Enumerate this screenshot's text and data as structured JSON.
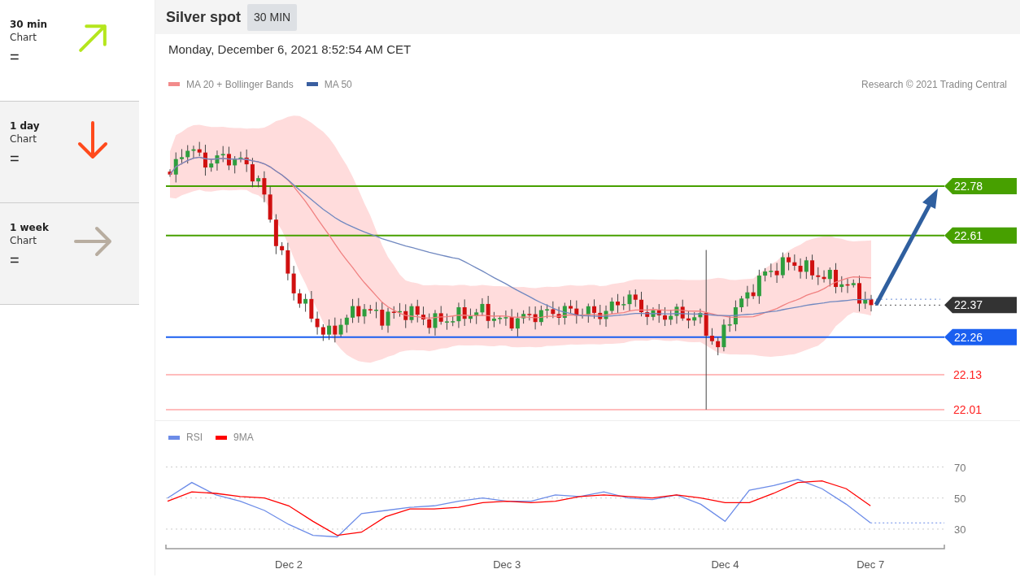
{
  "sidebar": {
    "items": [
      {
        "title": "30 min",
        "subtitle": "Chart",
        "sign": "=",
        "kind": "rising",
        "color": "#b5e61d",
        "selected": true
      },
      {
        "title": "1 day",
        "subtitle": "Chart",
        "sign": "=",
        "kind": "falling",
        "color": "#ff4a1c",
        "selected": false
      },
      {
        "title": "1 week",
        "subtitle": "Chart",
        "sign": "=",
        "kind": "flat",
        "color": "#b8ada0",
        "selected": false
      }
    ]
  },
  "header": {
    "title": "Silver spot",
    "badge": "30 MIN"
  },
  "timestamp": "Monday, December 6, 2021 8:52:54 AM CET",
  "price_chart": {
    "legend": [
      {
        "label": "MA 20 + Bollinger Bands",
        "color": "#f28b8b"
      },
      {
        "label": "MA 50",
        "color": "#3a5fa0"
      }
    ],
    "credit": "Research © 2021 Trading Central",
    "levels": [
      {
        "label": "22.78",
        "kind": "tag",
        "color": "#47a000"
      },
      {
        "label": "22.61",
        "kind": "tag",
        "color": "#47a000"
      },
      {
        "label": "22.37",
        "kind": "last",
        "color": "#333333"
      },
      {
        "label": "22.26",
        "kind": "tag",
        "color": "#1a5ff0"
      },
      {
        "label": "22.13",
        "kind": "text",
        "color": "#ff2020"
      },
      {
        "label": "22.01",
        "kind": "text",
        "color": "#ff2020"
      }
    ]
  },
  "rsi_chart": {
    "chart_data": {
      "type": "line",
      "grid": true,
      "ylim": [
        17.4,
        70
      ],
      "categories": [
        null,
        null,
        null,
        null,
        null,
        "Dec 2",
        null,
        null,
        null,
        null,
        null,
        null,
        null,
        null,
        "Dec 3",
        null,
        null,
        null,
        null,
        null,
        null,
        null,
        null,
        "Dec 4",
        null,
        null,
        null,
        null,
        null,
        "Dec 7"
      ],
      "yticks": [
        30,
        50,
        70
      ],
      "series": [
        {
          "name": "RSI",
          "color": "#6c8ce8",
          "values": [
            50,
            60,
            52,
            48,
            42,
            33,
            26,
            25,
            40,
            42,
            44,
            45,
            48,
            50,
            48,
            48,
            52,
            51,
            54,
            50,
            49,
            52,
            46,
            35,
            55,
            58,
            62,
            56,
            46,
            34
          ]
        },
        {
          "name": "9MA",
          "color": "#ff0000",
          "values": [
            48,
            54,
            53,
            51,
            50,
            45,
            35,
            26,
            28,
            38,
            43,
            43,
            44,
            47,
            48,
            47,
            48,
            51,
            52,
            51,
            50,
            52,
            50,
            47,
            47,
            53,
            60,
            61,
            56,
            45
          ]
        }
      ]
    }
  }
}
